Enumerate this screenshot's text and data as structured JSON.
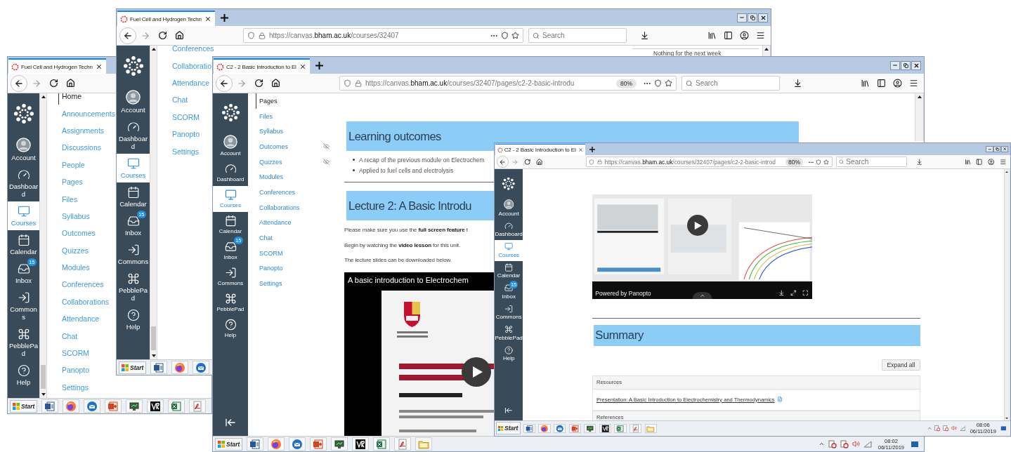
{
  "windows": [
    {
      "tab": {
        "title": "Fuel Cell and Hydrogen Techn",
        "selected": true
      },
      "global_nav": [
        {
          "kind": "logo",
          "selected": false
        },
        {
          "kind": "account",
          "label": "Account",
          "selected": false
        },
        {
          "kind": "dashboard",
          "label": "Dashboard",
          "selected": false
        },
        {
          "kind": "courses",
          "label": "Courses",
          "selected": true
        },
        {
          "kind": "calendar",
          "label": "Calendar",
          "selected": false
        },
        {
          "kind": "inbox",
          "label": "Inbox",
          "badge": "15",
          "selected": false
        },
        {
          "kind": "commons",
          "label": "Commons",
          "selected": false
        },
        {
          "kind": "pebblepad",
          "label": "PebblePad",
          "selected": false
        },
        {
          "kind": "help",
          "label": "Help",
          "selected": false
        }
      ],
      "course_menu": [
        {
          "label": "Home",
          "selected": true
        },
        {
          "label": "Announcements",
          "selected": false
        },
        {
          "label": "Assignments",
          "selected": false
        },
        {
          "label": "Discussions",
          "selected": false
        },
        {
          "label": "People",
          "selected": false
        },
        {
          "label": "Pages",
          "selected": false
        },
        {
          "label": "Files",
          "selected": false
        },
        {
          "label": "Syllabus",
          "selected": false
        },
        {
          "label": "Outcomes",
          "selected": false
        },
        {
          "label": "Quizzes",
          "selected": false
        },
        {
          "label": "Modules",
          "selected": false
        },
        {
          "label": "Conferences",
          "selected": false
        },
        {
          "label": "Collaborations",
          "selected": false
        },
        {
          "label": "Attendance",
          "selected": false
        },
        {
          "label": "Chat",
          "selected": false
        },
        {
          "label": "SCORM",
          "selected": false
        },
        {
          "label": "Panopto",
          "selected": false
        },
        {
          "label": "Settings",
          "selected": false
        }
      ],
      "taskbar": {
        "items": [
          {
            "kind": "start",
            "label": "Start"
          },
          {
            "kind": "word"
          },
          {
            "kind": "firefox"
          },
          {
            "kind": "thunderbird"
          },
          {
            "kind": "powerpoint"
          },
          {
            "kind": "monitor"
          },
          {
            "kind": "vr"
          },
          {
            "kind": "excel"
          },
          {
            "kind": "pdf"
          }
        ]
      }
    },
    {
      "tab": {
        "title": "Fuel Cell and Hydrogen Techn",
        "selected": true
      },
      "new_tab": true,
      "window_controls": true,
      "toolbar": {
        "url": "https://canvas.**bham.ac.uk**/courses/32407",
        "search_placeholder": "Search"
      },
      "global_nav": [
        {
          "kind": "logo",
          "selected": false
        },
        {
          "kind": "account",
          "label": "Account",
          "selected": false
        },
        {
          "kind": "dashboard",
          "label": "Dashboard",
          "selected": false
        },
        {
          "kind": "courses",
          "label": "Courses",
          "selected": true
        },
        {
          "kind": "calendar",
          "label": "Calendar",
          "selected": false
        },
        {
          "kind": "inbox",
          "label": "Inbox",
          "badge": "15",
          "selected": false
        },
        {
          "kind": "commons",
          "label": "Commons",
          "selected": false
        },
        {
          "kind": "pebblepad",
          "label": "PebblePad",
          "selected": false
        },
        {
          "kind": "help",
          "label": "Help",
          "selected": false
        }
      ],
      "course_menu": [
        {
          "label": "Conferences",
          "selected": false
        },
        {
          "label": "Collaboratio",
          "selected": false
        },
        {
          "label": "Attendance",
          "selected": false
        },
        {
          "label": "Chat",
          "selected": false
        },
        {
          "label": "SCORM",
          "selected": false
        },
        {
          "label": "Panopto",
          "selected": false
        },
        {
          "label": "Settings",
          "selected": false
        }
      ],
      "content": [
        {
          "kind": "aside_note",
          "text": "Nothing for the next week"
        }
      ],
      "taskbar": {
        "items": [
          {
            "kind": "start",
            "label": "Start"
          },
          {
            "kind": "word"
          },
          {
            "kind": "firefox"
          },
          {
            "kind": "thunderbird"
          }
        ]
      }
    },
    {
      "tab": {
        "title": "C2 - 2 Basic Introduction to El",
        "selected": true
      },
      "new_tab": true,
      "window_controls": true,
      "toolbar": {
        "url": "https://canvas.**bham.ac.uk**/courses/32407/pages/c2-2-basic-introdu",
        "zoom": "80%",
        "search_placeholder": "Search"
      },
      "global_nav": [
        {
          "kind": "logo",
          "selected": false
        },
        {
          "kind": "account",
          "label": "Account",
          "selected": false
        },
        {
          "kind": "dashboard",
          "label": "Dashboard",
          "selected": false
        },
        {
          "kind": "courses",
          "label": "Courses",
          "selected": true
        },
        {
          "kind": "calendar",
          "label": "Calendar",
          "selected": false
        },
        {
          "kind": "inbox",
          "label": "Inbox",
          "badge": "15",
          "selected": false
        },
        {
          "kind": "commons",
          "label": "Commons",
          "selected": false
        },
        {
          "kind": "pebblepad",
          "label": "PebblePad",
          "selected": false
        },
        {
          "kind": "help",
          "label": "Help",
          "selected": false
        },
        {
          "kind": "collapse",
          "selected": false
        }
      ],
      "course_menu": [
        {
          "label": "Pages",
          "selected": true,
          "hidden": false
        },
        {
          "label": "Files",
          "selected": false,
          "hidden": false
        },
        {
          "label": "Syllabus",
          "selected": false,
          "hidden": false
        },
        {
          "label": "Outcomes",
          "selected": false,
          "hidden": true
        },
        {
          "label": "Quizzes",
          "selected": false,
          "hidden": true
        },
        {
          "label": "Modules",
          "selected": false,
          "hidden": false
        },
        {
          "label": "Conferences",
          "selected": false,
          "hidden": false
        },
        {
          "label": "Collaborations",
          "selected": false,
          "hidden": false
        },
        {
          "label": "Attendance",
          "selected": false,
          "hidden": false
        },
        {
          "label": "Chat",
          "selected": false,
          "hidden": false
        },
        {
          "label": "SCORM",
          "selected": false,
          "hidden": false
        },
        {
          "label": "Panopto",
          "selected": false,
          "hidden": false
        },
        {
          "label": "Settings",
          "selected": false,
          "hidden": false
        }
      ],
      "content": [
        {
          "kind": "banner",
          "text": "Learning outcomes"
        },
        {
          "kind": "bullets",
          "items": [
            "A recap of the previous module on Electrochem",
            "Applied to fuel cells and electrolysis"
          ]
        },
        {
          "kind": "rule"
        },
        {
          "kind": "banner",
          "text": "Lecture 2: A Basic Introdu"
        },
        {
          "kind": "paragraph",
          "text": "Please make sure you use the **full screen feature** t"
        },
        {
          "kind": "paragraph",
          "text": "Begin by watching the **video lesson** for this unit."
        },
        {
          "kind": "paragraph",
          "text": "The lecture slides can be downloaded below."
        },
        {
          "kind": "video",
          "title": "A basic introduction to Electrochem"
        }
      ],
      "taskbar": {
        "items": [
          {
            "kind": "start",
            "label": "Start"
          },
          {
            "kind": "word"
          },
          {
            "kind": "firefox"
          },
          {
            "kind": "thunderbird"
          },
          {
            "kind": "powerpoint"
          },
          {
            "kind": "monitor"
          },
          {
            "kind": "vr"
          },
          {
            "kind": "excel"
          },
          {
            "kind": "pdf"
          },
          {
            "kind": "folder"
          }
        ],
        "tray": {
          "time": "08:02",
          "date": "06/11/2019"
        }
      }
    },
    {
      "tab": {
        "title": "C2 - 2 Basic Introduction to El",
        "selected": true
      },
      "new_tab": true,
      "window_controls": true,
      "toolbar": {
        "url": "https://canvas.**bham.ac.uk**/courses/32407/pages/c2-2-basic-introd",
        "zoom": "80%",
        "search_placeholder": "Search"
      },
      "global_nav": [
        {
          "kind": "logo",
          "selected": false
        },
        {
          "kind": "account",
          "label": "Account",
          "selected": false
        },
        {
          "kind": "dashboard",
          "label": "Dashboard",
          "selected": false
        },
        {
          "kind": "courses",
          "label": "Courses",
          "selected": true
        },
        {
          "kind": "calendar",
          "label": "Calendar",
          "selected": false
        },
        {
          "kind": "inbox",
          "label": "Inbox",
          "badge": "15",
          "selected": false
        },
        {
          "kind": "commons",
          "label": "Commons",
          "selected": false
        },
        {
          "kind": "pebblepad",
          "label": "PebblePad",
          "selected": false
        },
        {
          "kind": "help",
          "label": "Help",
          "selected": false
        },
        {
          "kind": "collapse",
          "selected": false
        }
      ],
      "content": [
        {
          "kind": "video",
          "caption": "Powered by Panopto"
        },
        {
          "kind": "rule"
        },
        {
          "kind": "banner",
          "text": "Summary"
        },
        {
          "kind": "button",
          "text": "Expand all"
        },
        {
          "kind": "accordion",
          "title": "Resources",
          "links": [
            "Presentation: A Basic Introduction to Electrochemistry and Thermodynamics"
          ]
        },
        {
          "kind": "accordion",
          "title": "References"
        }
      ],
      "taskbar": {
        "items": [
          {
            "kind": "start",
            "label": "Start"
          },
          {
            "kind": "word"
          },
          {
            "kind": "firefox"
          },
          {
            "kind": "thunderbird"
          },
          {
            "kind": "powerpoint"
          },
          {
            "kind": "monitor"
          },
          {
            "kind": "vr"
          },
          {
            "kind": "excel"
          },
          {
            "kind": "pdf"
          },
          {
            "kind": "folder"
          }
        ],
        "tray": {
          "time": "08:06",
          "date": "06/11/2019"
        }
      }
    }
  ]
}
